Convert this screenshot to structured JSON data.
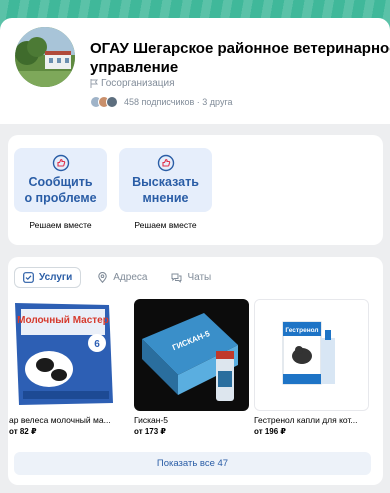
{
  "colors": {
    "cover": "#40b89a",
    "accent": "#2a5da6",
    "tile_bg": "#e6eefb",
    "muted": "#818c99"
  },
  "group": {
    "title_line1": "ОГАУ Шегарское районное ветеринарное",
    "title_line2": "управление",
    "type": "Госорганизация",
    "subscribers": "458 подписчиков · 3 друга"
  },
  "actions": [
    {
      "label_line1": "Сообщить",
      "label_line2": "о проблеме",
      "caption": "Решаем вместе",
      "icon": "thumbs-up-icon"
    },
    {
      "label_line1": "Высказать",
      "label_line2": "мнение",
      "caption": "Решаем вместе",
      "icon": "thumbs-up-icon"
    }
  ],
  "tabs": [
    {
      "label": "Услуги",
      "icon": "checkbox-icon",
      "active": true
    },
    {
      "label": "Адреса",
      "icon": "location-pin-icon",
      "active": false
    },
    {
      "label": "Чаты",
      "icon": "chat-icon",
      "active": false
    }
  ],
  "products": [
    {
      "name": "ар велеса молочный ма...",
      "price": "от 82 ₽",
      "image_text": "Молочный Мастер"
    },
    {
      "name": "Гискан-5",
      "price": "от 173 ₽",
      "image_text": "ГИСКАН-5"
    },
    {
      "name": "Гестренол капли для кот...",
      "price": "от 196 ₽",
      "image_text": "Гестренол"
    }
  ],
  "show_all_label": "Показать все 47"
}
